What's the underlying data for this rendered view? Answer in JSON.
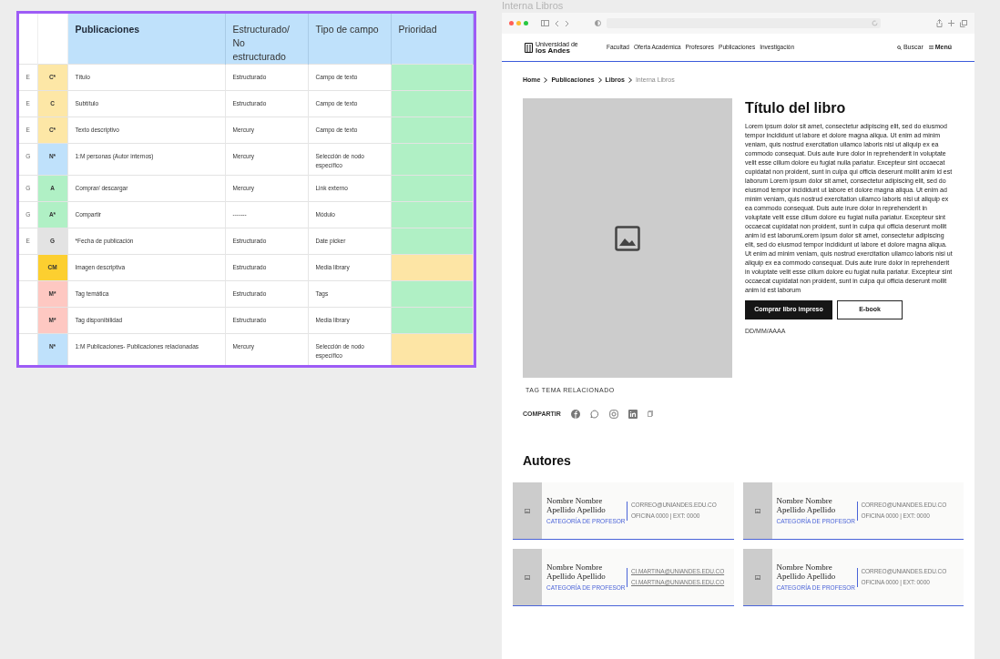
{
  "frame_label": "Interna Libros",
  "table": {
    "columns": [
      "Publicaciones",
      "Estructurado/ No estructurado",
      "Tipo de campo",
      "Prioridad"
    ],
    "rows": [
      {
        "group": "E",
        "code": {
          "text": "C*",
          "color": "#fde7a6"
        },
        "field": "Título",
        "structure": "Estructurado",
        "type": "Campo de texto",
        "priority": {
          "color": "#b0f0c5"
        }
      },
      {
        "group": "E",
        "code": {
          "text": "C",
          "color": "#fde7a6"
        },
        "field": "Subtítulo",
        "structure": "Estructurado",
        "type": "Campo de texto",
        "priority": {
          "color": "#b0f0c5"
        }
      },
      {
        "group": "E",
        "code": {
          "text": "C*",
          "color": "#fde7a6"
        },
        "field": "Texto descriptivo",
        "structure": "Mercury",
        "type": "Campo de texto",
        "priority": {
          "color": "#b0f0c5"
        }
      },
      {
        "group": "G",
        "code": {
          "text": "N*",
          "color": "#bfe1fb"
        },
        "field": "1:M personas (Autor internos)",
        "structure": "Mercury",
        "type": "Selección de nodo específico",
        "priority": {
          "color": "#b0f0c5"
        }
      },
      {
        "group": "G",
        "code": {
          "text": "A",
          "color": "#b0f0c5"
        },
        "field": "Comprar/ descargar",
        "structure": "Mercury",
        "type": "Link externo",
        "priority": {
          "color": "#b0f0c5"
        }
      },
      {
        "group": "G",
        "code": {
          "text": "A*",
          "color": "#b0f0c5"
        },
        "field": "Compartir",
        "structure": "-------",
        "type": "Módulo",
        "priority": {
          "color": "#b0f0c5"
        }
      },
      {
        "group": "E",
        "code": {
          "text": "G",
          "color": "#e3e3e3"
        },
        "field": "*Fecha de publicación",
        "structure": "Estructurado",
        "type": "Date picker",
        "priority": {
          "color": "#b0f0c5"
        }
      },
      {
        "code": {
          "text": "CM",
          "color": "#fccf30"
        },
        "field": "Imagen descriptiva",
        "structure": "Estructurado",
        "type": "Media library",
        "priority": {
          "color": "#fde5a5"
        }
      },
      {
        "code": {
          "text": "M*",
          "color": "#fec8c2"
        },
        "field": "Tag temática",
        "structure": "Estructurado",
        "type": "Tags",
        "priority": {
          "color": "#b0f0c5"
        }
      },
      {
        "code": {
          "text": "M*",
          "color": "#fec8c2"
        },
        "field": "Tag disponibilidad",
        "structure": "Estructurado",
        "type": "Media library",
        "priority": {
          "color": "#b0f0c5"
        }
      },
      {
        "code": {
          "text": "N*",
          "color": "#bfe1fb"
        },
        "field": "1:M Publicaciones- Publicaciones relacionadas",
        "structure": "Mercury",
        "type": "Selección de nodo específico",
        "priority": {
          "color": "#fde5a5"
        }
      }
    ]
  },
  "site": {
    "logo_top": "Universidad de",
    "logo_bottom": "los Andes",
    "nav": [
      "Facultad",
      "Oferta Académica",
      "Profesores",
      "Publicaciones",
      "Investigación"
    ],
    "search": "Buscar",
    "menu": "Menú",
    "breadcrumb": [
      {
        "label": "Home",
        "current": false
      },
      {
        "label": "Publicaciones",
        "current": false
      },
      {
        "label": "Libros",
        "current": false
      },
      {
        "label": "Interna Libros",
        "current": true
      }
    ],
    "title": "Título del libro",
    "description": "Lorem ipsum dolor sit amet, consectetur adipiscing elit, sed do eiusmod tempor incididunt ut labore et dolore magna aliqua. Ut enim ad minim veniam, quis nostrud exercitation ullamco laboris nisi ut aliquip ex ea commodo consequat. Duis aute irure dolor in reprehenderit in voluptate velit esse cillum dolore eu fugiat nulla pariatur. Excepteur sint occaecat cupidatat non proident, sunt in culpa qui officia deserunt mollit anim id est laborum Lorem ipsum dolor sit amet, consectetur adipiscing elit, sed do eiusmod tempor incididunt ut labore et dolore magna aliqua. Ut enim ad minim veniam, quis nostrud exercitation ullamco laboris nisi ut aliquip ex ea commodo consequat. Duis aute irure dolor in reprehenderit in voluptate velit esse cillum dolore eu fugiat nulla pariatur. Excepteur sint occaecat cupidatat non proident, sunt in culpa qui officia deserunt mollit anim id est laborumLorem ipsum dolor sit amet, consectetur adipiscing elit, sed do eiusmod tempor incididunt ut labore et dolore magna aliqua. Ut enim ad minim veniam, quis nostrud exercitation ullamco laboris nisi ut aliquip ex ea commodo consequat. Duis aute irure dolor in reprehenderit in voluptate velit esse cillum dolore eu fugiat nulla pariatur. Excepteur sint occaecat cupidatat non proident, sunt in culpa qui officia deserunt mollit anim id est laborum",
    "buttons": [
      {
        "label": "Comprar libro impreso",
        "kind": "primary"
      },
      {
        "label": "E-book",
        "kind": "outline"
      }
    ],
    "date": "DD/MM/AAAA",
    "tag": "TAG TEMA RELACIONADO",
    "share": "COMPARTIR",
    "authors_title": "Autores",
    "authors": [
      {
        "name": "Nombre Nombre Apellido Apellido",
        "category": "CATEGORÍA DE PROFESOR",
        "contact": [
          {
            "text": "CORREO@UNIANDES.EDU.CO",
            "kind": "text"
          },
          {
            "text": "OFICINA 0000 | EXT: 0000",
            "kind": "text"
          }
        ]
      },
      {
        "name": "Nombre Nombre Apellido Apellido",
        "category": "CATEGORÍA DE PROFESOR",
        "contact": [
          {
            "text": "CORREO@UNIANDES.EDU.CO",
            "kind": "text"
          },
          {
            "text": "OFICINA 0000 | EXT: 0000",
            "kind": "text"
          }
        ]
      },
      {
        "name": "Nombre Nombre Apellido Apellido",
        "category": "CATEGORÍA DE PROFESOR",
        "contact": [
          {
            "text": "CI.MARTINA@UNIANDES.EDU.CO",
            "kind": "link"
          },
          {
            "text": "CI.MARTINA@UNIANDES.EDU.CO",
            "kind": "link"
          }
        ]
      },
      {
        "name": "Nombre Nombre Apellido Apellido",
        "category": "CATEGORÍA DE PROFESOR",
        "contact": [
          {
            "text": "CORREO@UNIANDES.EDU.CO",
            "kind": "text"
          },
          {
            "text": "OFICINA 0000 | EXT: 0000",
            "kind": "text"
          }
        ]
      }
    ]
  }
}
